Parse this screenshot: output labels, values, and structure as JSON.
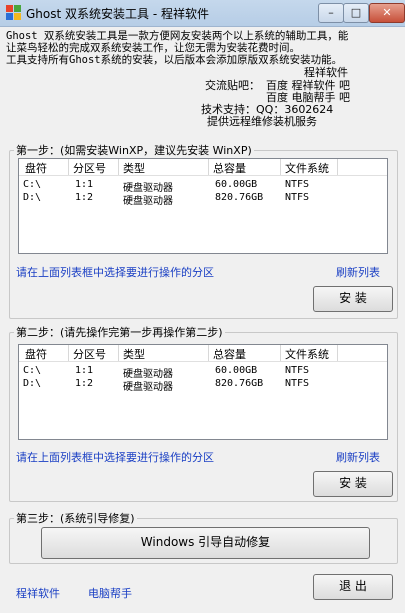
{
  "window": {
    "title": "Ghost 双系统安装工具 - 程祥软件",
    "min_glyph": "–",
    "max_glyph": "□",
    "close_glyph": "✕"
  },
  "intro": {
    "lines": [
      "Ghost 双系统安装工具是一款方便网友安装两个以上系统的辅助工具，能",
      "让菜鸟轻松的完成双系统安装工作，让您无需为安装花费时间。",
      "工具支持所有Ghost系统的安装，以后版本会添加原版双系统安装功能。"
    ],
    "author": "程祥软件",
    "exchange_label": "交流贴吧：",
    "bar1": "百度 程祥软件 吧",
    "bar2": "百度 电脑帮手 吧",
    "support": "技术支持：QQ：3602624",
    "remote": "提供远程维修装机服务"
  },
  "step1": {
    "legend": "第一步：(如需安装WinXP，建议先安装 WinXP)",
    "hint": "请在上面列表框中选择要进行操作的分区",
    "refresh": "刷新列表",
    "install": "安 装"
  },
  "step2": {
    "legend": "第二步：(请先操作完第一步再操作第二步)",
    "hint": "请在上面列表框中选择要进行操作的分区",
    "refresh": "刷新列表",
    "install": "安 装"
  },
  "columns": [
    "盘符",
    "分区号",
    "类型",
    "总容量",
    "文件系统"
  ],
  "partitions": [
    [
      "C:\\",
      "1:1",
      "硬盘驱动器",
      "60.00GB",
      "NTFS"
    ],
    [
      "D:\\",
      "1:2",
      "硬盘驱动器",
      "820.76GB",
      "NTFS"
    ]
  ],
  "step3": {
    "legend": "第三步：(系统引导修复)",
    "repair": "Windows 引导自动修复"
  },
  "footer": {
    "link1": "程祥软件",
    "link2": "电脑帮手",
    "exit": "退 出"
  },
  "colors": {
    "link": "#1a3fc4",
    "title_bg": "#c5d8ec",
    "window_bg": "#f0f0f0"
  }
}
